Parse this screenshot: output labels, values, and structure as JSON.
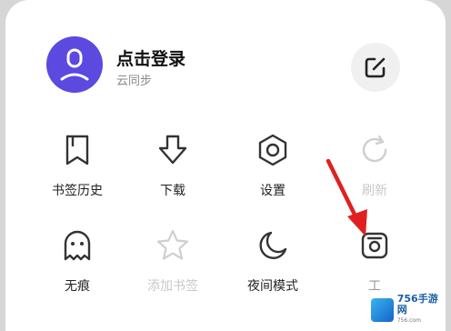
{
  "account": {
    "login_label": "点击登录",
    "sync_label": "云同步"
  },
  "icons": {
    "avatar": "user-avatar-icon",
    "edit": "edit-icon"
  },
  "menu": {
    "items": [
      {
        "label": "书签历史",
        "icon": "bookmark-icon",
        "disabled": false
      },
      {
        "label": "下载",
        "icon": "download-icon",
        "disabled": false
      },
      {
        "label": "设置",
        "icon": "settings-icon",
        "disabled": false
      },
      {
        "label": "刷新",
        "icon": "refresh-icon",
        "disabled": true
      },
      {
        "label": "无痕",
        "icon": "ghost-icon",
        "disabled": false
      },
      {
        "label": "添加书签",
        "icon": "star-icon",
        "disabled": true
      },
      {
        "label": "夜间模式",
        "icon": "moon-icon",
        "disabled": false
      },
      {
        "label": "工",
        "icon": "toolbox-icon",
        "disabled": false
      }
    ]
  },
  "watermark": {
    "text": "756手游网",
    "sub": "756.com"
  },
  "colors": {
    "avatar_bg": "#5b49e0",
    "annotation_arrow": "#e02020",
    "disabled_text": "#c8c8c8"
  }
}
